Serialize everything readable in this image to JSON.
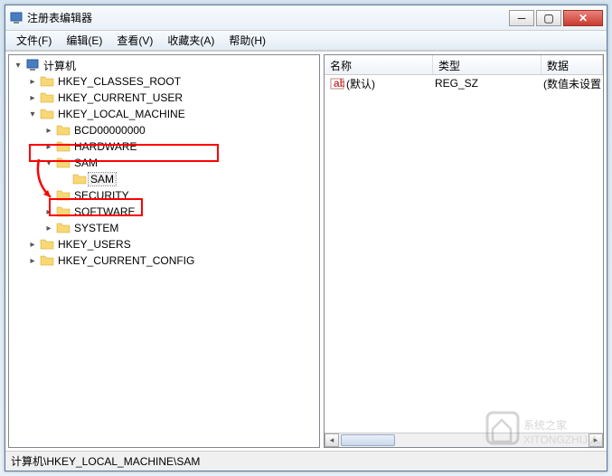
{
  "window": {
    "title": "注册表编辑器"
  },
  "menu": {
    "file": "文件(F)",
    "edit": "编辑(E)",
    "view": "查看(V)",
    "favorites": "收藏夹(A)",
    "help": "帮助(H)"
  },
  "tree": {
    "root": "计算机",
    "hkcr": "HKEY_CLASSES_ROOT",
    "hkcu": "HKEY_CURRENT_USER",
    "hklm": "HKEY_LOCAL_MACHINE",
    "bcd": "BCD00000000",
    "hardware": "HARDWARE",
    "sam": "SAM",
    "sam_child": "SAM",
    "security": "SECURITY",
    "software": "SOFTWARE",
    "system": "SYSTEM",
    "hku": "HKEY_USERS",
    "hkcc": "HKEY_CURRENT_CONFIG"
  },
  "list": {
    "headers": {
      "name": "名称",
      "type": "类型",
      "data": "数据"
    },
    "rows": [
      {
        "name": "(默认)",
        "type": "REG_SZ",
        "data": "(数值未设置"
      }
    ]
  },
  "statusbar": {
    "path": "计算机\\HKEY_LOCAL_MACHINE\\SAM"
  },
  "watermark": "系统之家"
}
